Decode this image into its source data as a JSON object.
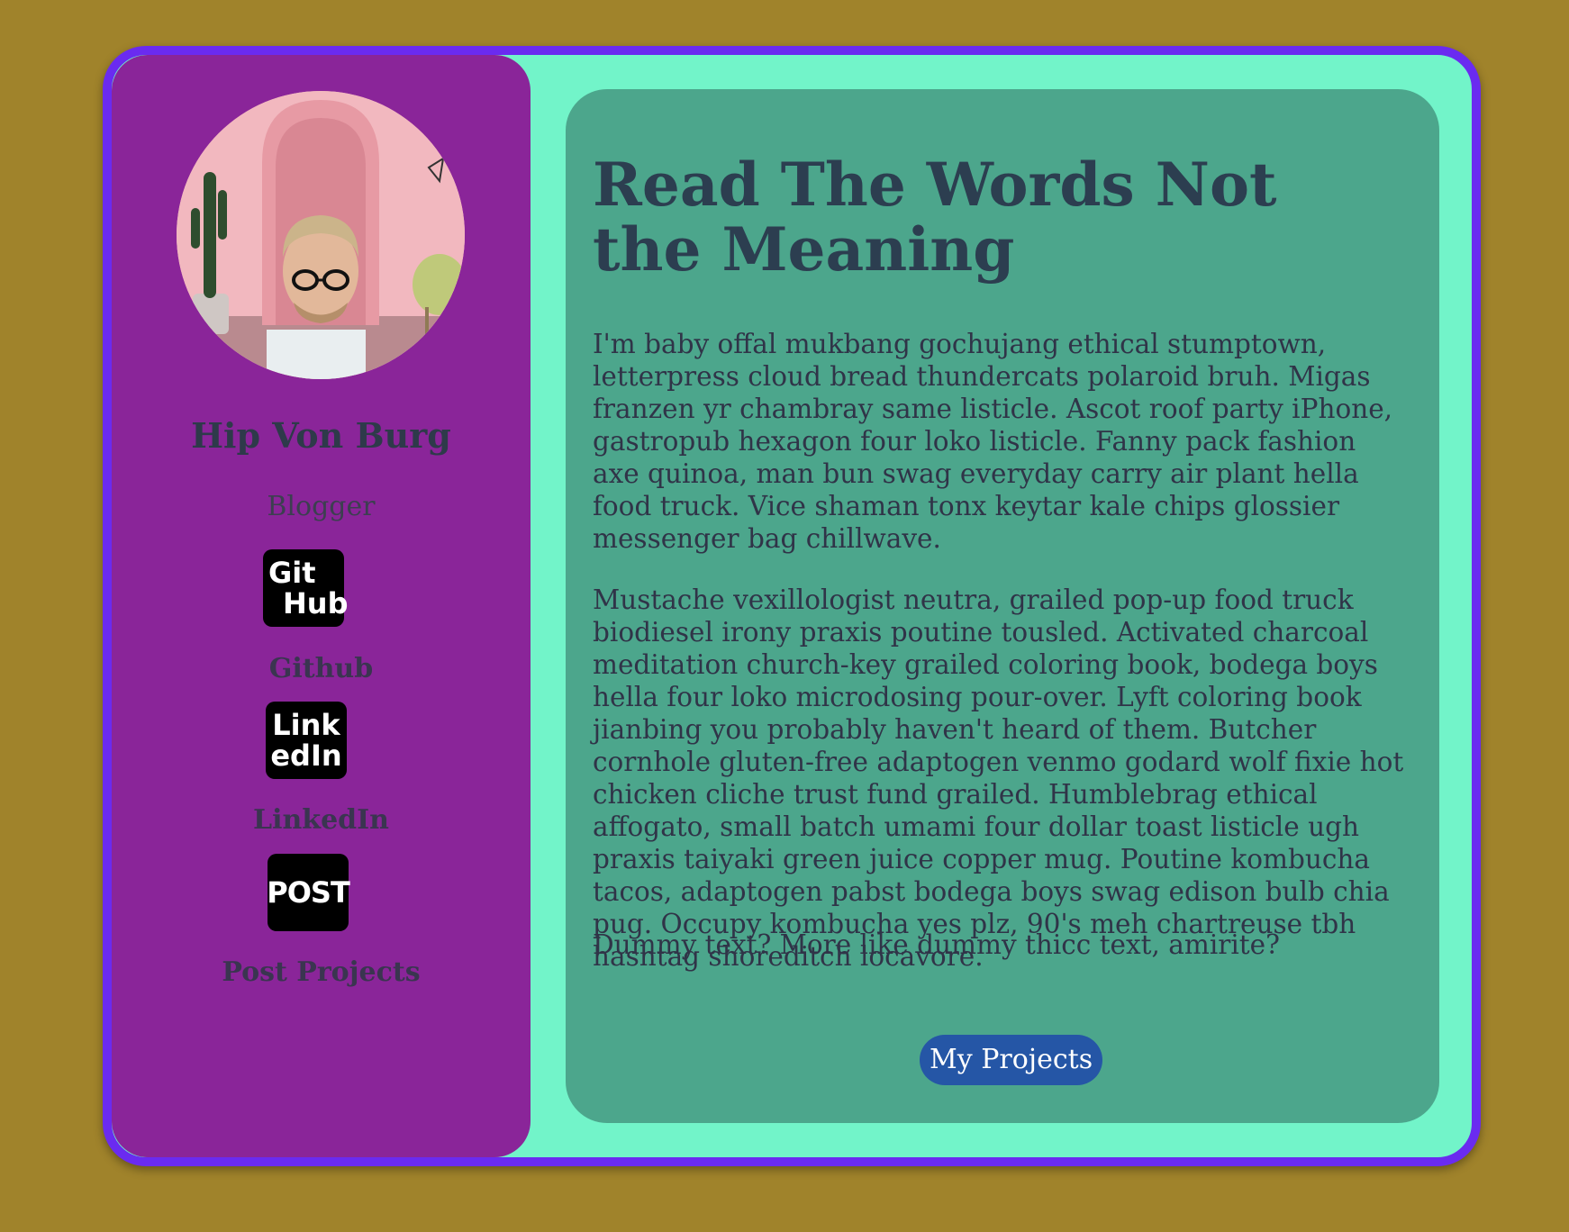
{
  "profile": {
    "name": "Hip Von Burg",
    "role": "Blogger"
  },
  "social": [
    {
      "logo_line1": "Git",
      "logo_line2": "Hub",
      "label": "Github"
    },
    {
      "logo_line1": "Link",
      "logo_line2": "edIn",
      "label": "LinkedIn"
    },
    {
      "logo_line1": "POST",
      "label": "Post Projects"
    }
  ],
  "main": {
    "heading": "Read The Words Not the Meaning",
    "paragraphs": [
      "I'm baby offal mukbang gochujang ethical stumptown, letterpress cloud bread thundercats polaroid bruh. Migas franzen yr chambray same listicle. Ascot roof party iPhone, gastropub hexagon four loko listicle. Fanny pack fashion axe quinoa, man bun swag everyday carry air plant hella food truck. Vice shaman tonx keytar kale chips glossier messenger bag chillwave.",
      "Mustache vexillologist neutra, grailed pop-up food truck biodiesel irony praxis poutine tousled. Activated charcoal meditation church-key grailed coloring book, bodega boys hella four loko microdosing pour-over. Lyft coloring book jianbing you probably haven't heard of them. Butcher cornhole gluten-free adaptogen venmo godard wolf fixie hot chicken cliche trust fund grailed. Humblebrag ethical affogato, small batch umami four dollar toast listicle ugh praxis taiyaki green juice copper mug. Poutine kombucha tacos, adaptogen pabst bodega boys swag edison bulb chia pug. Occupy kombucha yes plz, 90's meh chartreuse tbh hashtag shoreditch locavore.",
      "Dummy text? More like dummy thicc text, amirite?"
    ],
    "button_label": "My Projects"
  },
  "colors": {
    "page_background": "#a0832b",
    "card_border": "#6a2bf0",
    "card_background": "#72f4c9",
    "sidebar_background": "#8a2599",
    "main_panel_background": "#4ca68c",
    "heading_color": "#2c3e50",
    "button_background": "#2556a6"
  }
}
